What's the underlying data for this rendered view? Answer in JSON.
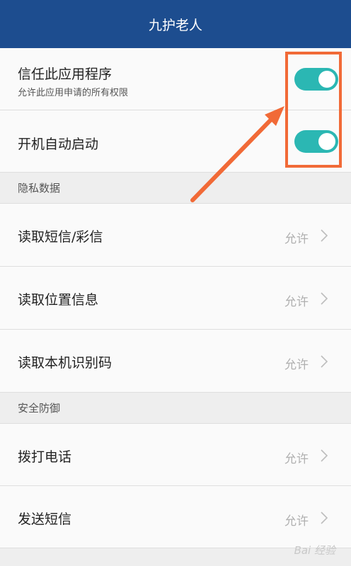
{
  "header": {
    "title": "九护老人"
  },
  "trust": {
    "label": "信任此应用程序",
    "sub": "允许此应用申请的所有权限",
    "enabled": true
  },
  "autostart": {
    "label": "开机自动启动",
    "enabled": true
  },
  "privacy": {
    "section_label": "隐私数据",
    "items": [
      {
        "label": "读取短信/彩信",
        "value": "允许"
      },
      {
        "label": "读取位置信息",
        "value": "允许"
      },
      {
        "label": "读取本机识别码",
        "value": "允许"
      }
    ]
  },
  "security": {
    "section_label": "安全防御",
    "items": [
      {
        "label": "拨打电话",
        "value": "允许"
      },
      {
        "label": "发送短信",
        "value": "允许"
      }
    ]
  },
  "annotation": {
    "color": "#f16a37"
  },
  "colors": {
    "header": "#1d4d8f",
    "toggle_on": "#2bb7b3"
  },
  "watermark": "Bai 经验"
}
